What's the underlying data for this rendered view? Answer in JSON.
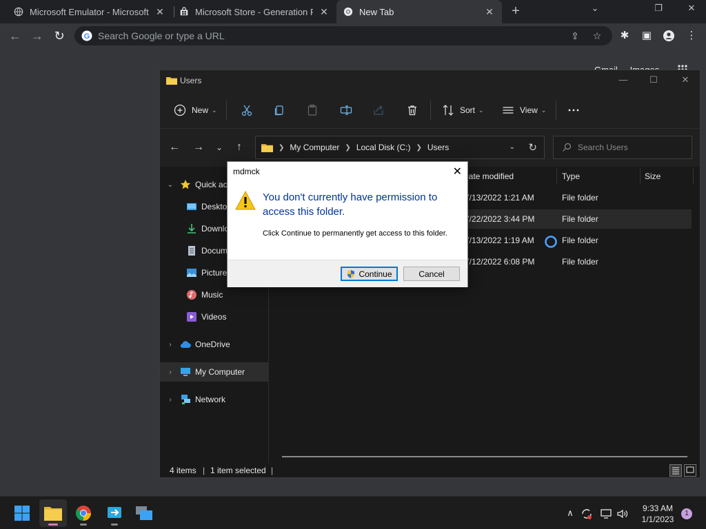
{
  "browser": {
    "tabs": [
      {
        "label": "Microsoft Emulator - Microsoft St"
      },
      {
        "label": "Microsoft Store - Generation Proj"
      },
      {
        "label": "New Tab"
      }
    ],
    "omnibox_placeholder": "Search Google or type a URL",
    "ntp_links": [
      "Gmail",
      "Images"
    ]
  },
  "explorer": {
    "title": "Users",
    "commands": {
      "new": "New",
      "sort": "Sort",
      "view": "View"
    },
    "breadcrumb": [
      "My Computer",
      "Local Disk (C:)",
      "Users"
    ],
    "search_placeholder": "Search Users",
    "nav": [
      {
        "label": "Quick access"
      },
      {
        "label": "Desktop"
      },
      {
        "label": "Downloads"
      },
      {
        "label": "Documents"
      },
      {
        "label": "Pictures"
      },
      {
        "label": "Music"
      },
      {
        "label": "Videos"
      },
      {
        "label": "OneDrive"
      },
      {
        "label": "My Computer"
      },
      {
        "label": "Network"
      }
    ],
    "columns": {
      "date": "Date modified",
      "type": "Type",
      "size": "Size"
    },
    "rows": [
      {
        "date": "7/13/2022 1:21 AM",
        "type": "File folder"
      },
      {
        "date": "7/22/2022 3:44 PM",
        "type": "File folder"
      },
      {
        "date": "7/13/2022 1:19 AM",
        "type": "File folder"
      },
      {
        "date": "7/12/2022 6:08 PM",
        "type": "File folder"
      }
    ],
    "status": {
      "count": "4 items",
      "selected": "1 item selected"
    }
  },
  "dialog": {
    "title": "mdmck",
    "main": "You don't currently have permission to access this folder.",
    "sub": "Click Continue to permanently get access to this folder.",
    "continue": "Continue",
    "cancel": "Cancel"
  },
  "taskbar": {
    "time": "9:33 AM",
    "date": "1/1/2023",
    "notifications": "1"
  }
}
